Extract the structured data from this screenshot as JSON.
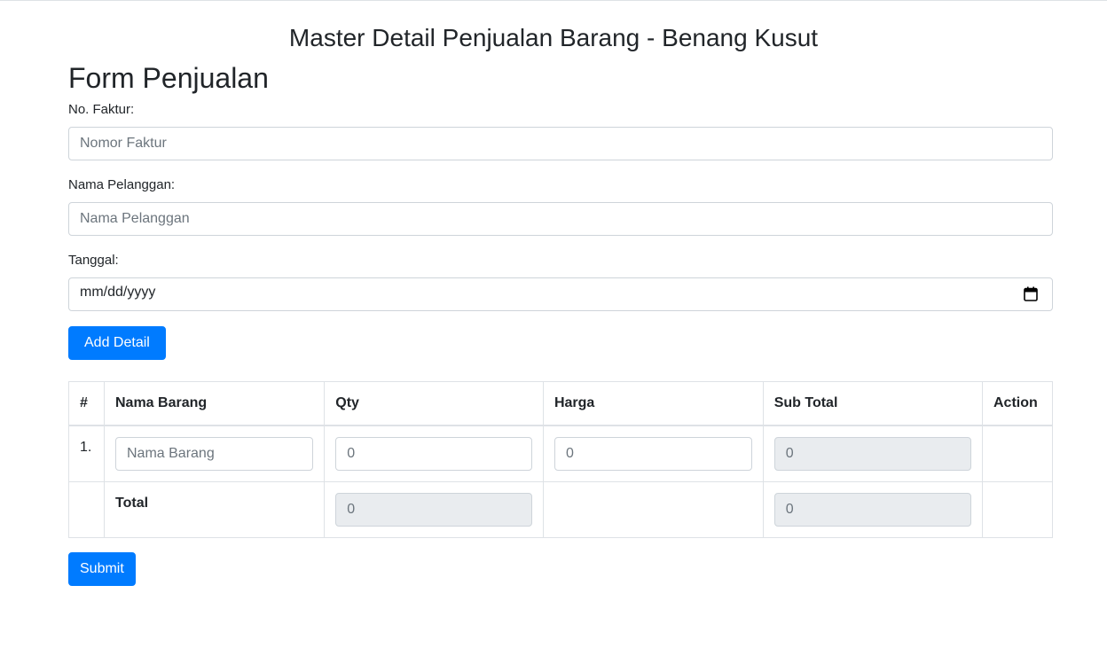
{
  "page": {
    "title": "Master Detail Penjualan Barang - Benang Kusut"
  },
  "form": {
    "heading": "Form Penjualan",
    "faktur": {
      "label": "No. Faktur:",
      "placeholder": "Nomor Faktur"
    },
    "pelanggan": {
      "label": "Nama Pelanggan:",
      "placeholder": "Nama Pelanggan"
    },
    "tanggal": {
      "label": "Tanggal:",
      "display": "mm/dd/yyyy"
    },
    "add_detail_label": "Add Detail",
    "submit_label": "Submit"
  },
  "table": {
    "headers": [
      "#",
      "Nama Barang",
      "Qty",
      "Harga",
      "Sub Total",
      "Action"
    ],
    "rows": [
      {
        "no": "1.",
        "nama_barang_placeholder": "Nama Barang",
        "qty_placeholder": "0",
        "harga_placeholder": "0",
        "subtotal_placeholder": "0"
      }
    ],
    "total": {
      "label": "Total",
      "qty_placeholder": "0",
      "subtotal_placeholder": "0"
    }
  },
  "colors": {
    "primary": "#007bff",
    "border": "#dee2e6",
    "readonly_bg": "#e9ecef"
  }
}
